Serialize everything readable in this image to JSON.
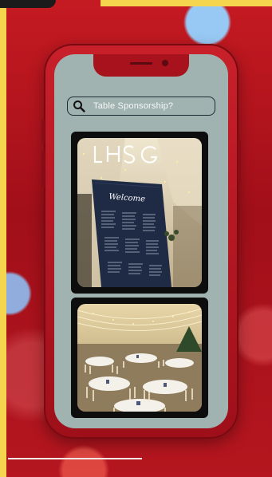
{
  "search": {
    "text": "Table Sponsorship?"
  },
  "icons": {
    "search": "search-icon"
  },
  "photos": [
    {
      "name": "welcome-seating-plan-photo",
      "sign_neon": "LHSG",
      "sign_script": "Welcome"
    },
    {
      "name": "marquee-banquet-tables-photo"
    }
  ],
  "colors": {
    "background": "#b3131d",
    "phone_frame": "#c8202b",
    "screen": "#a0b3b0",
    "accent_yellow": "#f6d54e"
  }
}
